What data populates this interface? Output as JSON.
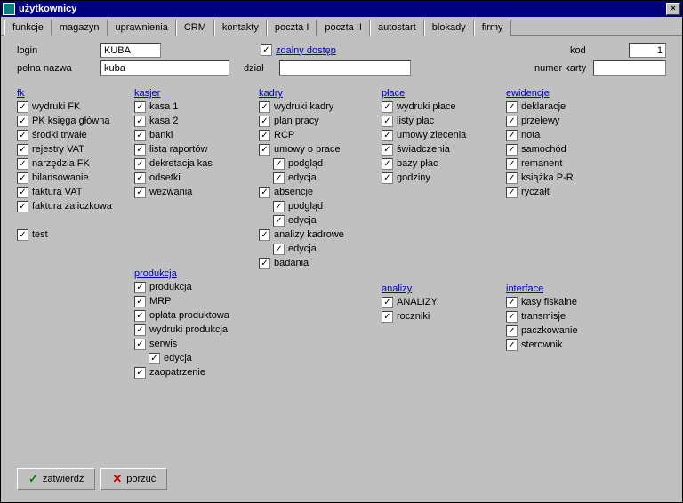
{
  "window": {
    "title": "użytkownicy"
  },
  "tabs": {
    "active": "funkcje",
    "items": [
      "funkcje",
      "magazyn",
      "uprawnienia",
      "CRM",
      "kontakty",
      "poczta I",
      "poczta II",
      "autostart",
      "blokady",
      "firmy"
    ]
  },
  "top": {
    "login_label": "login",
    "login_value": "KUBA",
    "pelna_label": "pełna nazwa",
    "pelna_value": "kuba",
    "dzial_label": "dział",
    "dzial_value": "",
    "zdalny_label": "zdalny dostęp",
    "kod_label": "kod",
    "kod_value": "1",
    "karta_label": "numer karty",
    "karta_value": ""
  },
  "sections": {
    "fk": {
      "title": "fk",
      "items": [
        "wydruki FK",
        "PK księga główna",
        "środki trwałe",
        "rejestry VAT",
        "narzędzia FK",
        "bilansowanie",
        "faktura VAT",
        "faktura zaliczkowa"
      ],
      "extra": "test"
    },
    "kasjer": {
      "title": "kasjer",
      "items": [
        "kasa 1",
        "kasa 2",
        "banki",
        "lista raportów",
        "dekretacja kas",
        "odsetki",
        "wezwania"
      ]
    },
    "produkcja": {
      "title": "produkcja",
      "items": [
        "produkcja",
        "MRP",
        "opłata produktowa",
        "wydruki produkcja",
        "serwis"
      ],
      "sub_serwis": "edycja",
      "items2": [
        "zaopatrzenie"
      ]
    },
    "kadry": {
      "title": "kadry",
      "items": [
        "wydruki kadry",
        "plan pracy",
        "RCP",
        "umowy o prace"
      ],
      "sub_umowy": [
        "podgląd",
        "edycja"
      ],
      "items2": [
        "absencje"
      ],
      "sub_absencje": [
        "podgląd",
        "edycja"
      ],
      "items3": [
        "analizy kadrowe"
      ],
      "sub_analizy": [
        "edycja"
      ],
      "items4": [
        "badania"
      ]
    },
    "place": {
      "title": "płace",
      "items": [
        "wydruki płace",
        "listy płac",
        "umowy zlecenia",
        "świadczenia",
        "bazy płac",
        "godziny"
      ]
    },
    "analizy": {
      "title": "analizy",
      "items": [
        "ANALIZY",
        "roczniki"
      ]
    },
    "ewidencje": {
      "title": "ewidencje",
      "items": [
        "deklaracje",
        "przelewy",
        "nota",
        "samochód",
        "remanent",
        "książka P-R",
        "ryczałt"
      ]
    },
    "interface": {
      "title": "interface",
      "items": [
        "kasy fiskalne",
        "transmisje",
        "paczkowanie",
        "sterownik"
      ]
    }
  },
  "footer": {
    "ok": "zatwierdź",
    "cancel": "porzuć"
  }
}
